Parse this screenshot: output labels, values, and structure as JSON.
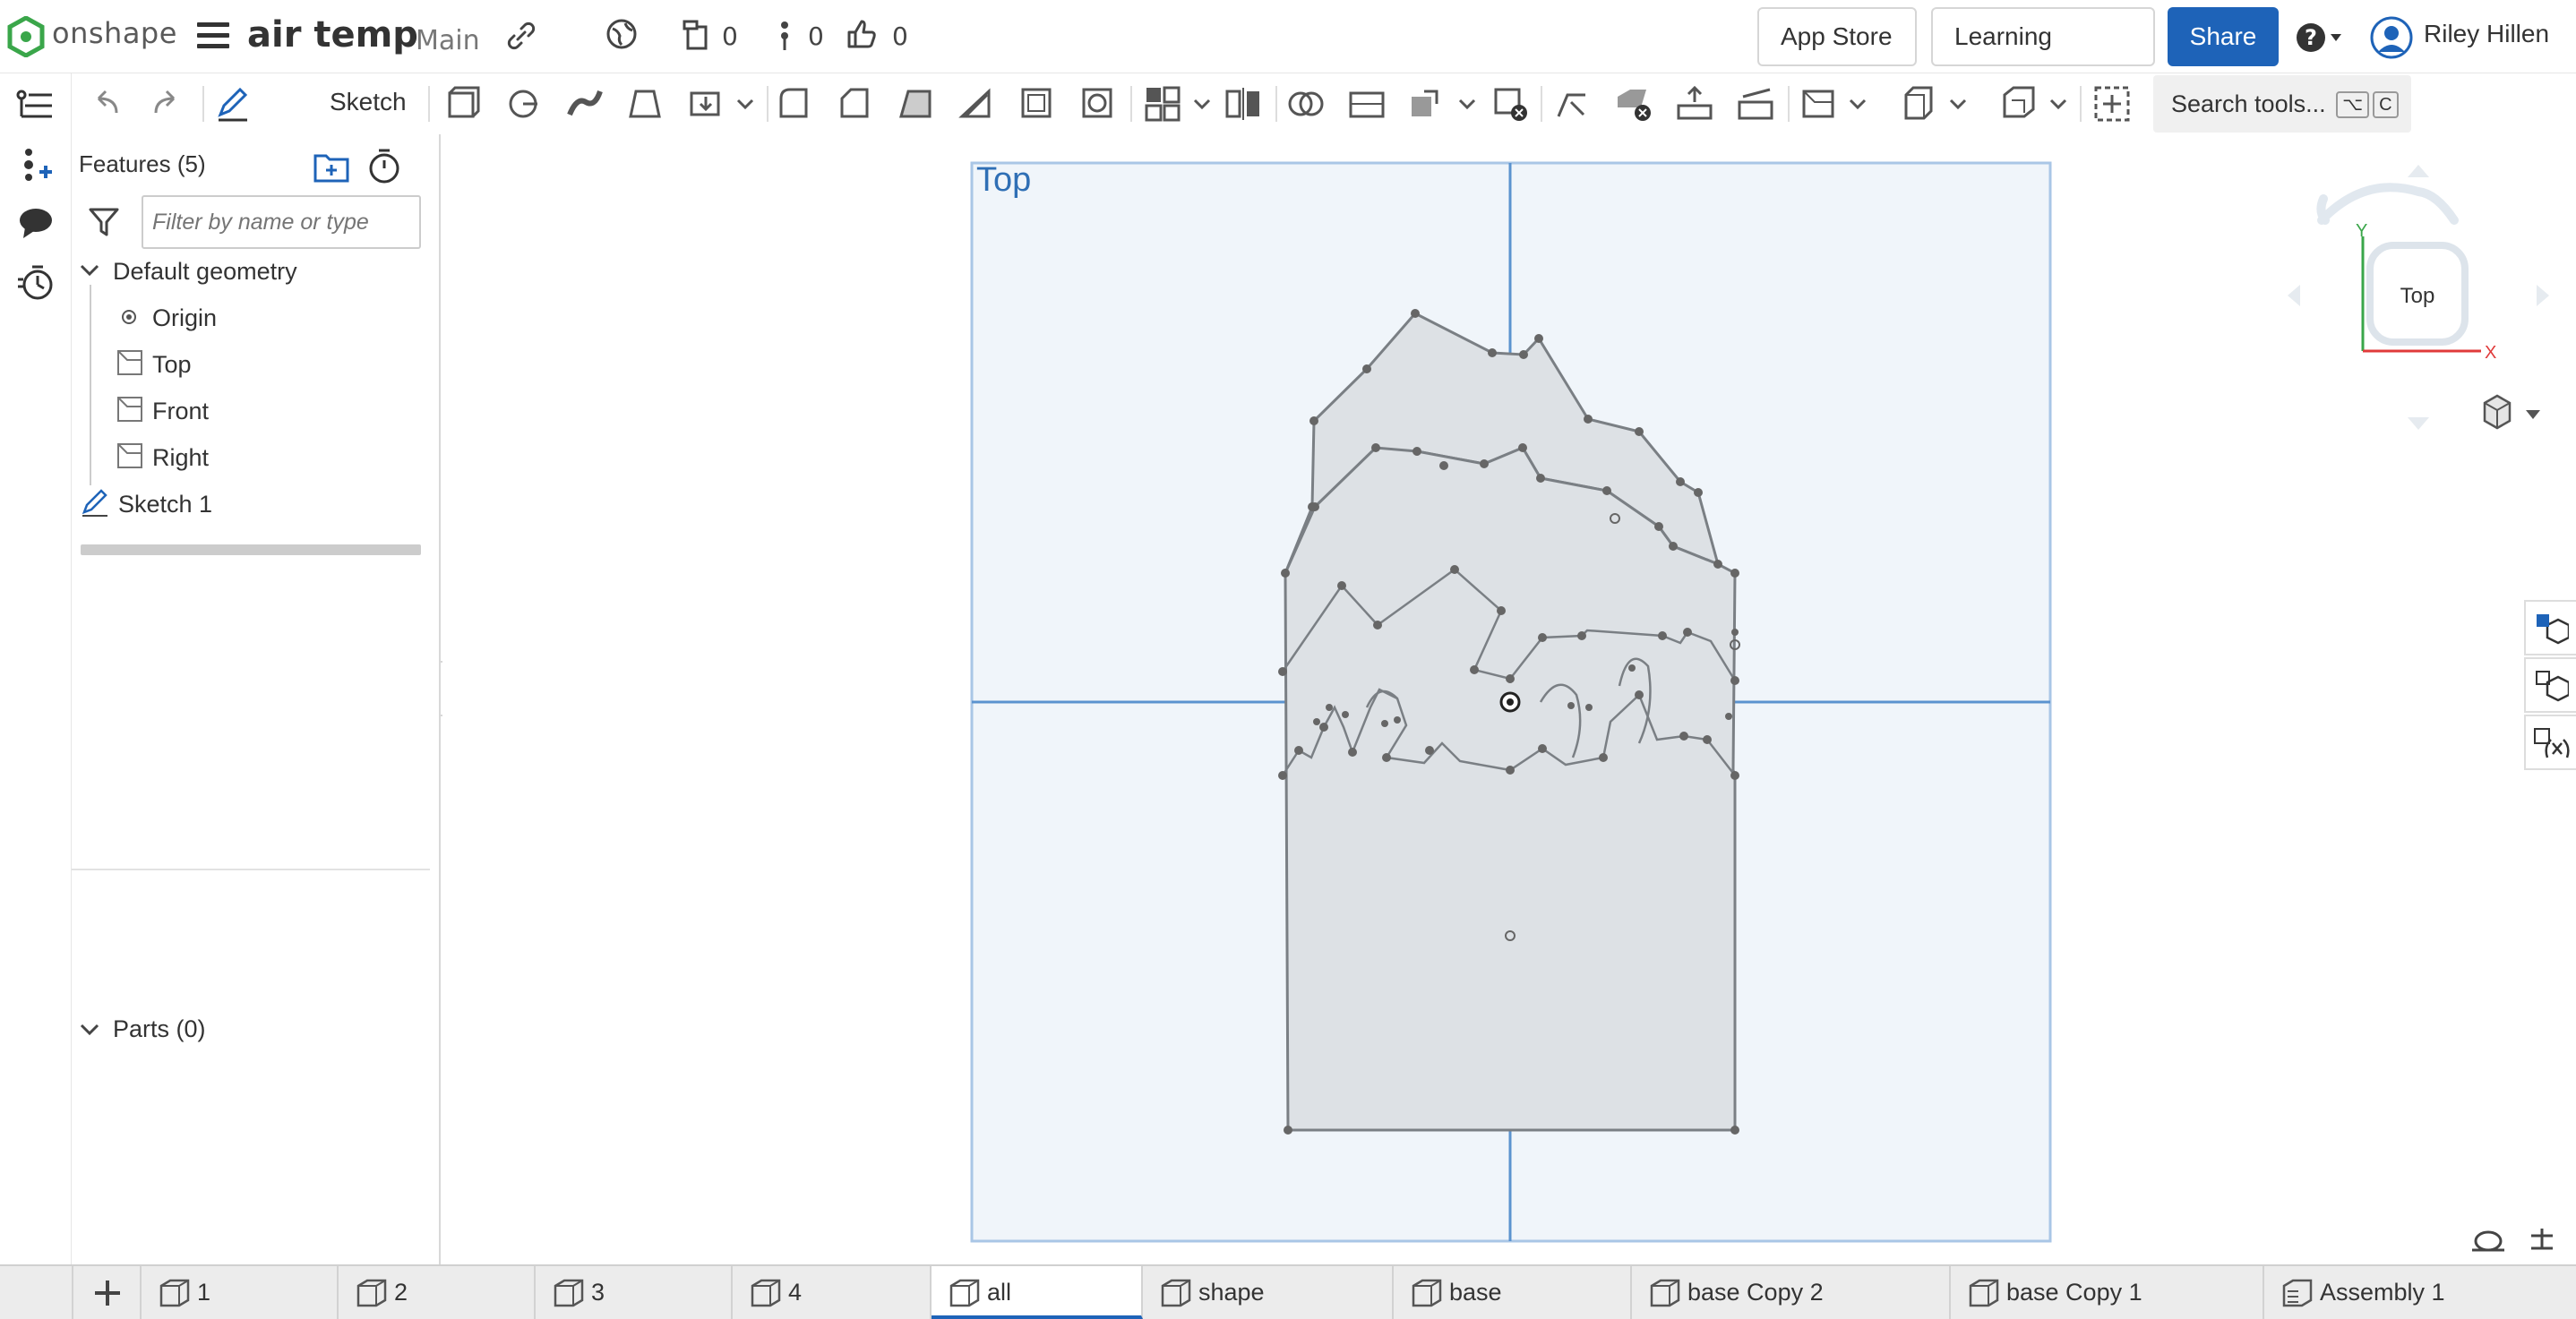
{
  "header": {
    "brand": "onshape",
    "document_name": "air temp",
    "branch": "Main",
    "versions_count": "0",
    "branches_count": "0",
    "likes_count": "0",
    "app_store_label": "App Store",
    "learning_center_label": "Learning Center",
    "share_label": "Share",
    "user_name": "Riley Hillen"
  },
  "toolbar": {
    "sketch_label": "Sketch",
    "search_label": "Search tools...",
    "search_key1": "⌥",
    "search_key2": "C"
  },
  "feature_panel": {
    "title": "Features (5)",
    "filter_placeholder": "Filter by name or type",
    "default_geometry_label": "Default geometry",
    "items": [
      {
        "label": "Origin",
        "icon": "origin-icon"
      },
      {
        "label": "Top",
        "icon": "plane-icon"
      },
      {
        "label": "Front",
        "icon": "plane-icon"
      },
      {
        "label": "Right",
        "icon": "plane-icon"
      }
    ],
    "sketch_label": "Sketch 1",
    "parts_label": "Parts (0)"
  },
  "viewport": {
    "plane_label": "Top",
    "view_cube_label": "Top",
    "axis_y": "Y",
    "axis_x": "X"
  },
  "tabs": [
    {
      "label": "1",
      "icon": "part-studio-icon"
    },
    {
      "label": "2",
      "icon": "part-studio-icon"
    },
    {
      "label": "3",
      "icon": "part-studio-icon"
    },
    {
      "label": "4",
      "icon": "part-studio-icon"
    },
    {
      "label": "all",
      "icon": "part-studio-icon",
      "active": true
    },
    {
      "label": "shape",
      "icon": "part-studio-icon"
    },
    {
      "label": "base",
      "icon": "part-studio-icon"
    },
    {
      "label": "base Copy 2",
      "icon": "part-studio-icon"
    },
    {
      "label": "base Copy 1",
      "icon": "part-studio-icon"
    },
    {
      "label": "Assembly 1",
      "icon": "assembly-icon"
    }
  ],
  "colors": {
    "accent": "#1e63b8",
    "plane_fill": "#f0f5fa",
    "plane_stroke": "#a9c6e6",
    "sketch_fill": "#dde1e5",
    "sketch_stroke": "#7a7f84",
    "axis_green": "#3aa64a",
    "axis_red": "#e03a3a"
  }
}
